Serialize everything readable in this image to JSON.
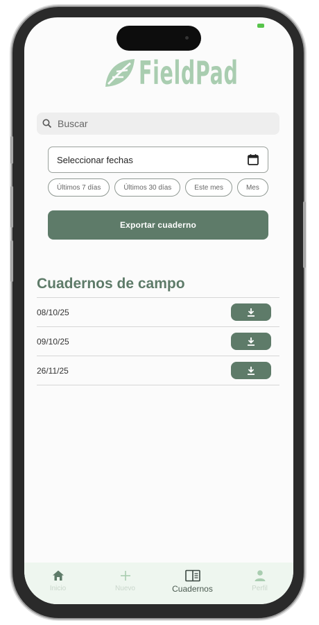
{
  "app": {
    "logo_text": "FieldPad"
  },
  "search": {
    "placeholder": "Buscar"
  },
  "date_picker": {
    "label": "Seleccionar fechas"
  },
  "chips": [
    "Últimos 7 días",
    "Últimos 30 días",
    "Este mes",
    "Mes"
  ],
  "export_button": {
    "label": "Exportar cuaderno"
  },
  "section": {
    "title": "Cuadernos de campo"
  },
  "notebooks": [
    {
      "date": "08/10/25"
    },
    {
      "date": "09/10/25"
    },
    {
      "date": "26/11/25"
    }
  ],
  "nav": {
    "items": [
      {
        "label": "Inicio",
        "icon": "home-icon"
      },
      {
        "label": "Nuevo",
        "icon": "plus-icon"
      },
      {
        "label": "Cuadernos",
        "icon": "book-icon",
        "active": true
      },
      {
        "label": "Perfil",
        "icon": "person-icon"
      }
    ]
  },
  "colors": {
    "accent": "#5e7b69",
    "logo": "#a9cdb0",
    "nav_bg": "#eef6ef"
  }
}
